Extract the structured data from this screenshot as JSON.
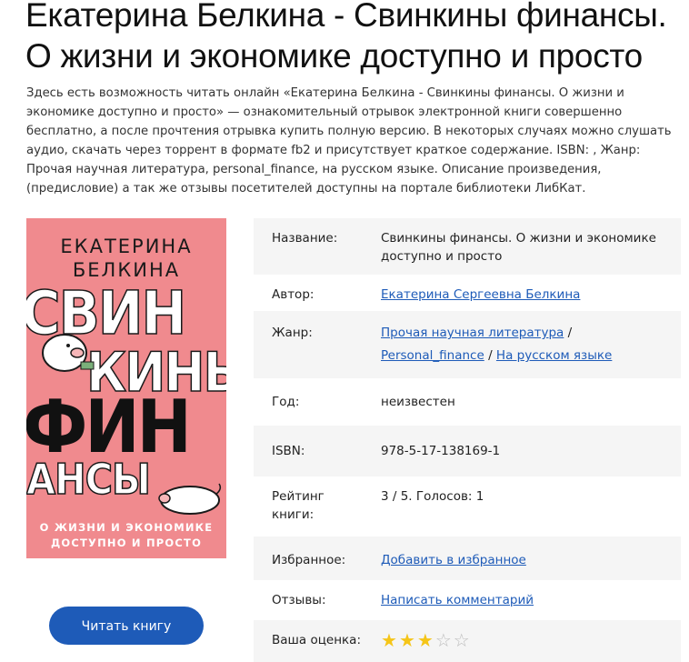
{
  "title": "Екатерина Белкина - Свинкины финансы. О жизни и экономике доступно и просто",
  "description": "Здесь есть возможность читать онлайн «Екатерина Белкина - Свинкины финансы. О жизни и экономике доступно и просто» — ознакомительный отрывок электронной книги совершенно бесплатно, а после прочтения отрывка купить полную версию. В некоторых случаях можно слушать аудио, скачать через торрент в формате fb2 и присутствует краткое содержание. ISBN: , Жанр: Прочая научная литература, personal_finance, на русском языке. Описание произведения, (предисловие) а так же отзывы посетителей доступны на портале библиотеки ЛибКат.",
  "cover": {
    "author": "ЕКАТЕРИНА БЕЛКИНА",
    "word1": "СВИН",
    "word2": "КИНЫ",
    "word3": "ФИН",
    "word4": "АНСЫ",
    "subtitle_line1": "О ЖИЗНИ И ЭКОНОМИКЕ",
    "subtitle_line2": "ДОСТУПНО И ПРОСТО"
  },
  "read_button": "Читать книгу",
  "info": {
    "name_label": "Название:",
    "name_value": "Свинкины финансы. О жизни и экономике доступно и просто",
    "author_label": "Автор:",
    "author_value": "Екатерина Сергеевна Белкина",
    "genre_label": "Жанр:",
    "genre_1": "Прочая научная литература",
    "genre_2": "Personal_finance",
    "genre_3": "На русском языке",
    "genre_sep": "/",
    "year_label": "Год:",
    "year_value": "неизвестен",
    "isbn_label": "ISBN:",
    "isbn_value": "978-5-17-138169-1",
    "rating_label": "Рейтинг книги:",
    "rating_value": "3 / 5. Голосов: 1",
    "fav_label": "Избранное:",
    "fav_value": "Добавить в избранное",
    "reviews_label": "Отзывы:",
    "reviews_value": "Написать комментарий",
    "your_rating_label": "Ваша оценка:",
    "your_rating_stars": 3,
    "your_rating_max": 5
  },
  "colors": {
    "accent": "#1e5bb8",
    "cover_bg": "#f08a8e",
    "star": "#f5c518"
  }
}
